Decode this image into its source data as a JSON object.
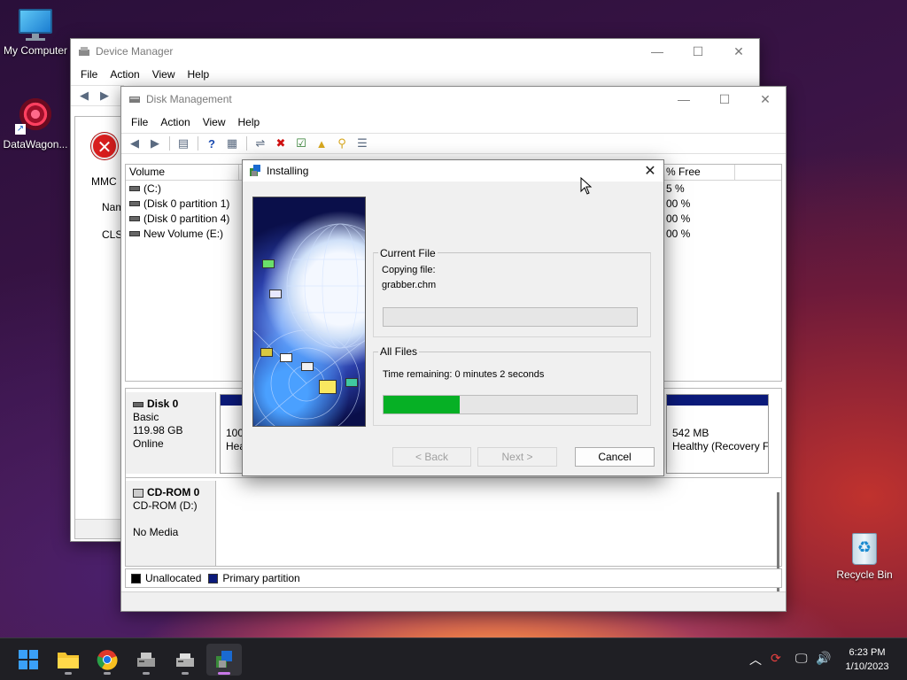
{
  "desktop": {
    "icons": [
      {
        "label": "My Computer"
      },
      {
        "label": "DataWagon..."
      },
      {
        "label": "Recycle Bin"
      }
    ]
  },
  "device_manager": {
    "title": "Device Manager",
    "menu": [
      "File",
      "Action",
      "View",
      "Help"
    ],
    "partial_text": [
      "MMC",
      "Nam",
      "CLSI"
    ]
  },
  "disk_management": {
    "title": "Disk Management",
    "menu": [
      "File",
      "Action",
      "View",
      "Help"
    ],
    "columns": {
      "volume": "Volume",
      "free": "% Free"
    },
    "rows": [
      {
        "volume": "(C:)",
        "free": "5 %"
      },
      {
        "volume": "(Disk 0 partition 1)",
        "free": "00 %"
      },
      {
        "volume": "(Disk 0 partition 4)",
        "free": "00 %"
      },
      {
        "volume": "New Volume (E:)",
        "free": "00 %"
      }
    ],
    "disks": [
      {
        "name": "Disk 0",
        "type": "Basic",
        "size": "119.98 GB",
        "status": "Online"
      },
      {
        "name": "CD-ROM 0",
        "type": "CD-ROM (D:)",
        "size": "",
        "status": "No Media"
      }
    ],
    "partial_volumes": {
      "left_size": "100",
      "left_status": "Hea",
      "right_size": "542 MB",
      "right_status": "Healthy (Recovery F"
    },
    "legend": [
      "Unallocated",
      "Primary partition"
    ],
    "colors": {
      "unallocated": "#000000",
      "primary": "#0b1a7a"
    }
  },
  "installing_dialog": {
    "title": "Installing",
    "current_file_label": "Current File",
    "copying_label": "Copying file:",
    "file_name": "grabber.chm",
    "current_progress": 0,
    "all_files_label": "All Files",
    "time_remaining": "Time remaining: 0 minutes 2 seconds",
    "all_progress": 0.3,
    "buttons": {
      "back": "< Back",
      "next": "Next >",
      "cancel": "Cancel"
    },
    "progress_color": "#06b025"
  },
  "taskbar": {
    "apps": [
      "start-icon",
      "file-explorer-icon",
      "chrome-icon",
      "device-manager-icon",
      "disk-management-icon",
      "installer-icon"
    ],
    "clock": {
      "time": "6:23 PM",
      "date": "1/10/2023"
    }
  }
}
